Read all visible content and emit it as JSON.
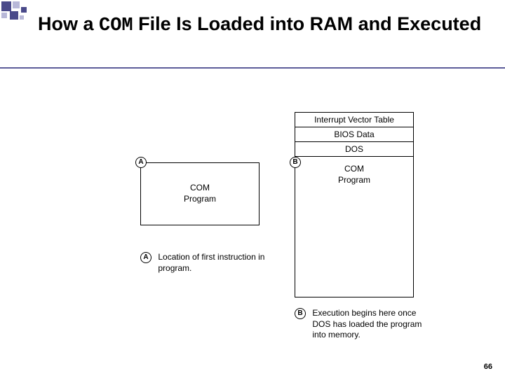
{
  "title_part1": "How a ",
  "title_mono": "COM",
  "title_part2": " File Is Loaded into RAM and Executed",
  "memory": {
    "ivt": "Interrupt Vector Table",
    "bios": "BIOS Data",
    "dos": "DOS",
    "com_line1": "COM",
    "com_line2": "Program"
  },
  "markers": {
    "a": "A",
    "b": "B"
  },
  "legend": {
    "a": "Location of first instruction in program.",
    "b": "Execution begins here once DOS has loaded the program into memory."
  },
  "page_number": "66"
}
